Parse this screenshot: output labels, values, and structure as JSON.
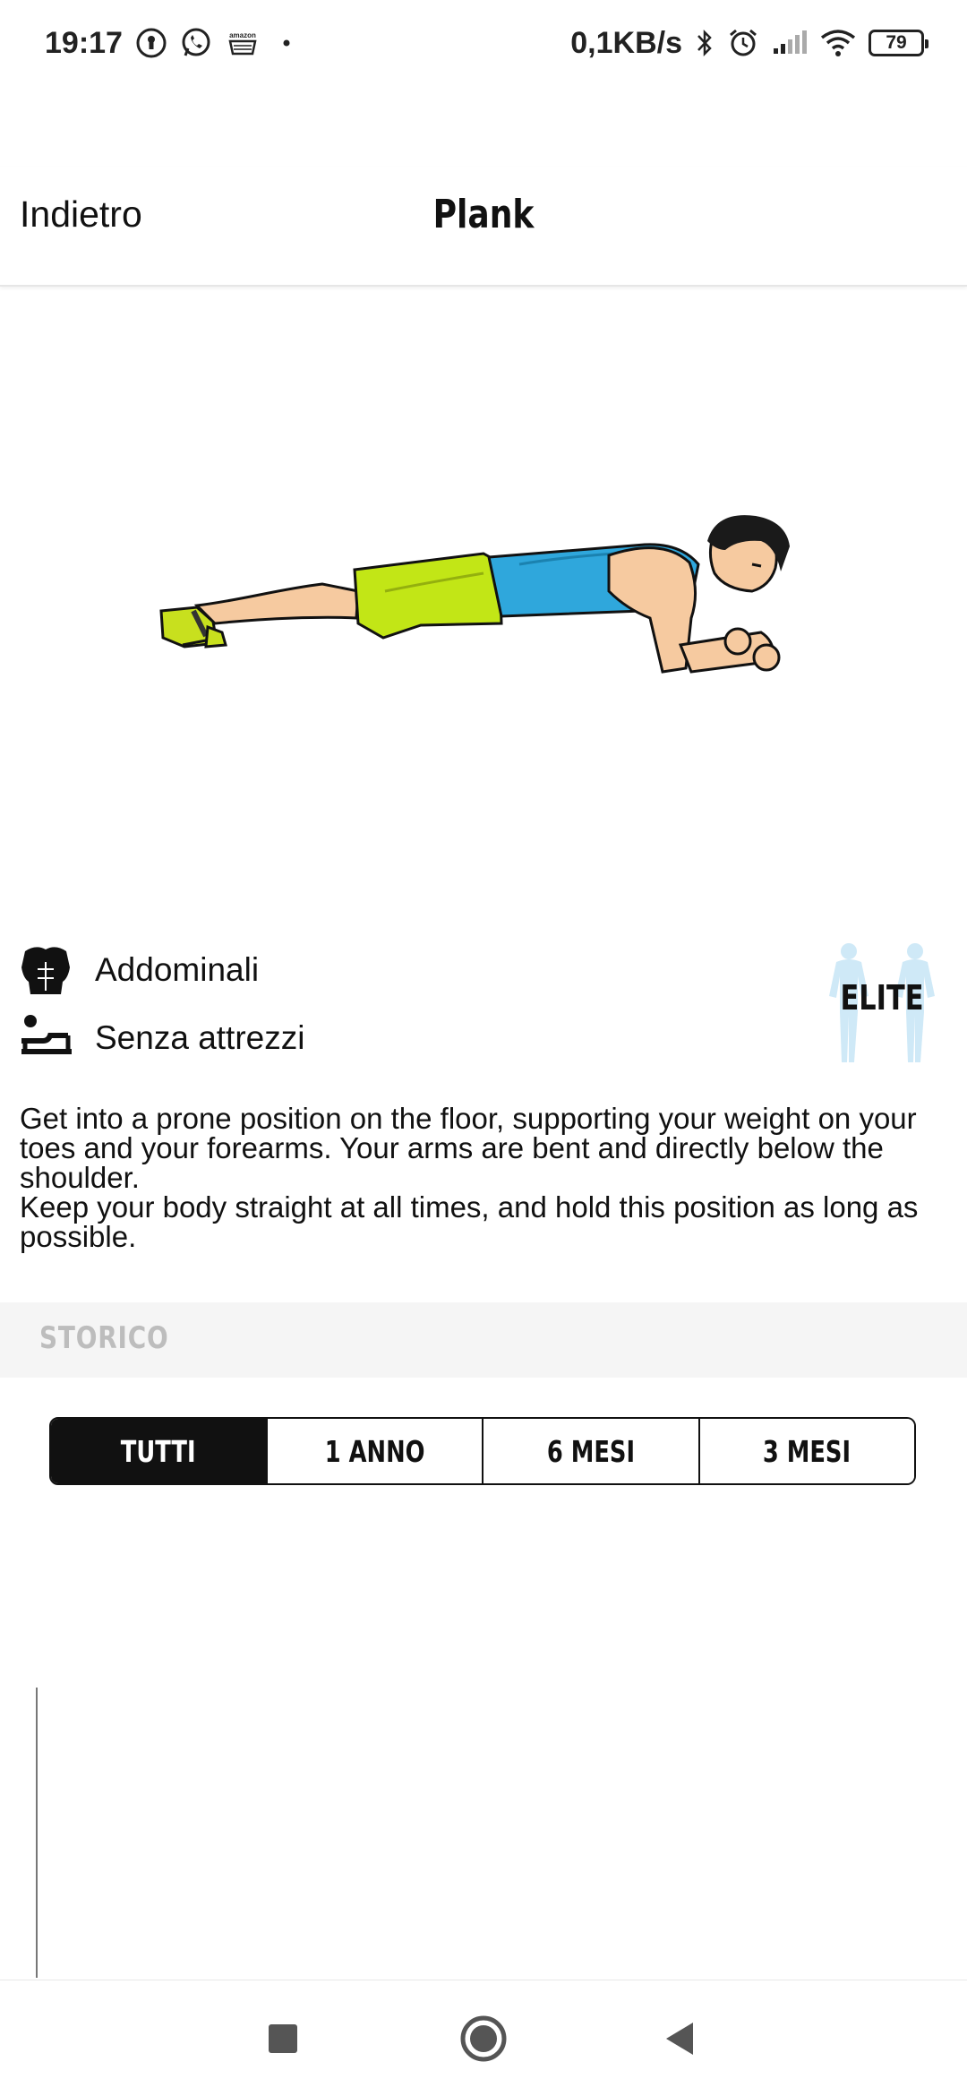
{
  "status_bar": {
    "time": "19:17",
    "network_speed": "0,1KB/s",
    "battery": "79",
    "left_icons": [
      "keyhole-icon",
      "whatsapp-icon",
      "amazon-icon",
      "notification-dot-icon"
    ],
    "right_icons": [
      "bluetooth-icon",
      "alarm-icon",
      "signal-icon",
      "wifi-icon",
      "battery-icon"
    ]
  },
  "header": {
    "back_label": "Indietro",
    "title": "Plank"
  },
  "exercise": {
    "muscle_group": "Addominali",
    "muscle_icon": "torso-icon",
    "equipment": "Senza attrezzi",
    "equipment_icon": "bodyweight-icon",
    "level": "ELITE",
    "description": "Get into a prone position on the floor, supporting your weight on your toes and your forearms. Your arms are bent and directly below the shoulder.\nKeep your body straight at all times, and hold this position as long as possible."
  },
  "history": {
    "section_title": "STORICO",
    "ranges": [
      {
        "label": "TUTTI",
        "selected": true
      },
      {
        "label": "1 ANNO",
        "selected": false
      },
      {
        "label": "6 MESI",
        "selected": false
      },
      {
        "label": "3 MESI",
        "selected": false
      }
    ]
  },
  "navbar": {
    "icons": [
      "recent-apps-icon",
      "home-icon",
      "back-icon"
    ]
  },
  "colors": {
    "accent": "#111111",
    "section_bg": "#f5f5f5",
    "section_text": "#bdbdbd",
    "elite_figure": "#cfe9f7"
  }
}
